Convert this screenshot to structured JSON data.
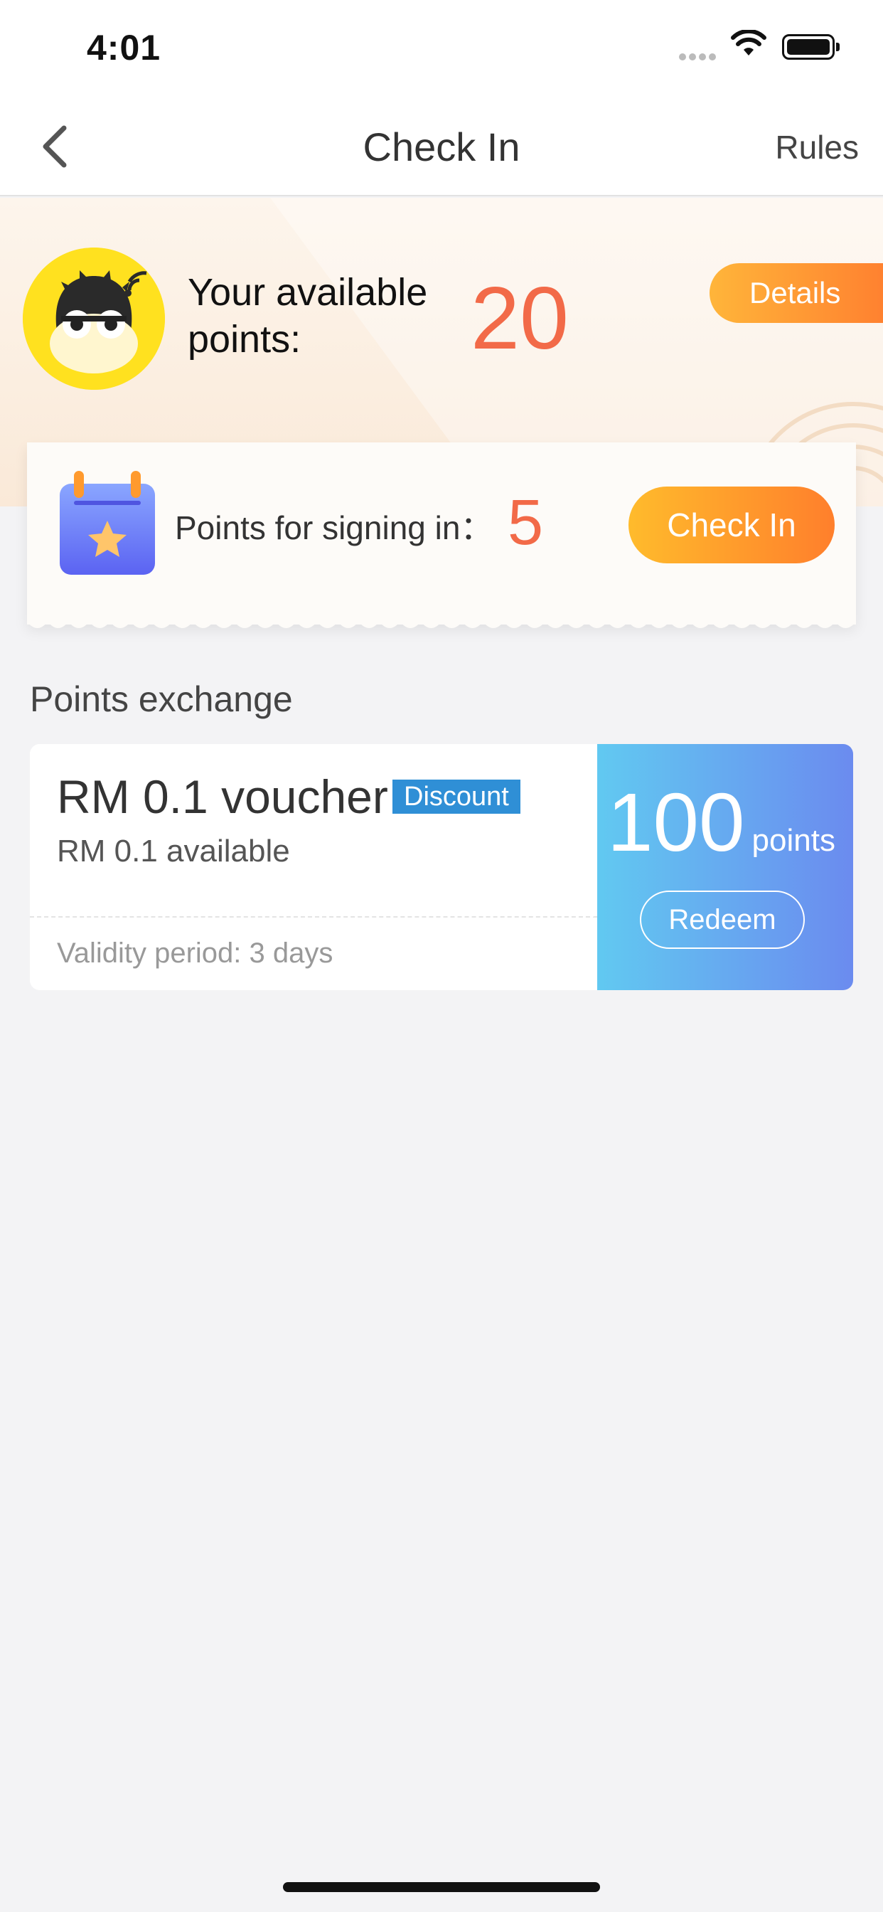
{
  "status_bar": {
    "time": "4:01",
    "icons": [
      "signal-icon",
      "wifi-icon",
      "battery-icon"
    ]
  },
  "navbar": {
    "title": "Check In",
    "rules_label": "Rules",
    "back_icon": "chevron-left-icon"
  },
  "points_card": {
    "label": "Your available points:",
    "value": "20",
    "details_label": "Details",
    "avatar_icon": "mascot-avatar-icon"
  },
  "checkin": {
    "label": "Points for signing in：",
    "value": "5",
    "button_label": "Check In",
    "icon": "calendar-star-icon"
  },
  "exchange": {
    "section_title": "Points exchange",
    "vouchers": [
      {
        "title": "RM 0.1 voucher",
        "tag": "Discount",
        "subtitle": "RM 0.1 available",
        "validity": "Validity period: 3 days",
        "cost": "100",
        "cost_unit": "points",
        "redeem_label": "Redeem"
      }
    ]
  },
  "colors": {
    "accent_orange": "#ff8a2e",
    "points_red": "#f26a48",
    "tag_blue": "#2f8fd6",
    "voucher_gradient_start": "#61c9f1",
    "voucher_gradient_end": "#6b8bef"
  }
}
